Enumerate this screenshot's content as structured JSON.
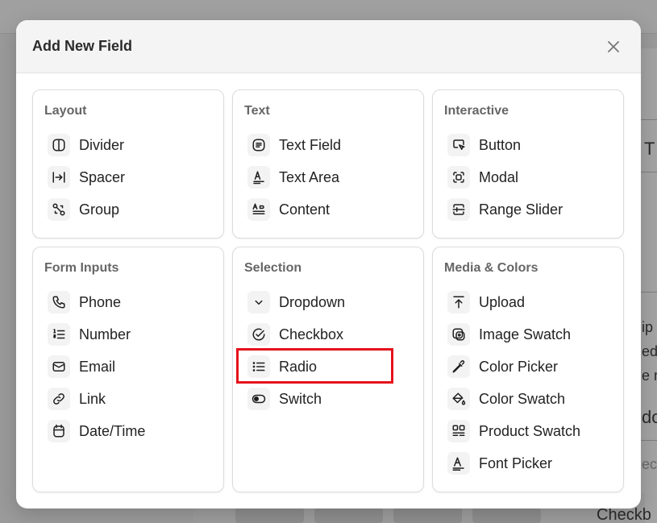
{
  "background": {
    "frag_right_top": "T",
    "frag_right_mid1": "ip",
    "frag_right_mid2": "ed",
    "frag_right_mid3": "e m",
    "frag_right_mid4": "do",
    "frag_right_mid5": "ect",
    "frag_bottom_right": "Checkb"
  },
  "modal": {
    "title": "Add New Field",
    "close_label": "×"
  },
  "sections": [
    {
      "title": "Layout",
      "items": [
        {
          "label": "Divider",
          "icon": "divider-icon"
        },
        {
          "label": "Spacer",
          "icon": "spacer-icon"
        },
        {
          "label": "Group",
          "icon": "group-icon"
        }
      ]
    },
    {
      "title": "Text",
      "items": [
        {
          "label": "Text Field",
          "icon": "text-field-icon"
        },
        {
          "label": "Text Area",
          "icon": "text-area-icon"
        },
        {
          "label": "Content",
          "icon": "content-icon"
        }
      ]
    },
    {
      "title": "Interactive",
      "items": [
        {
          "label": "Button",
          "icon": "button-icon"
        },
        {
          "label": "Modal",
          "icon": "modal-icon"
        },
        {
          "label": "Range Slider",
          "icon": "range-slider-icon"
        }
      ]
    },
    {
      "title": "Form Inputs",
      "items": [
        {
          "label": "Phone",
          "icon": "phone-icon"
        },
        {
          "label": "Number",
          "icon": "number-list-icon"
        },
        {
          "label": "Email",
          "icon": "email-icon"
        },
        {
          "label": "Link",
          "icon": "link-icon"
        },
        {
          "label": "Date/Time",
          "icon": "calendar-icon"
        }
      ]
    },
    {
      "title": "Selection",
      "items": [
        {
          "label": "Dropdown",
          "icon": "chevron-down-icon"
        },
        {
          "label": "Checkbox",
          "icon": "check-circle-icon"
        },
        {
          "label": "Radio",
          "icon": "list-icon"
        },
        {
          "label": "Switch",
          "icon": "toggle-icon"
        }
      ]
    },
    {
      "title": "Media & Colors",
      "items": [
        {
          "label": "Upload",
          "icon": "upload-icon"
        },
        {
          "label": "Image Swatch",
          "icon": "image-swatch-icon"
        },
        {
          "label": "Color Picker",
          "icon": "eyedropper-icon"
        },
        {
          "label": "Color Swatch",
          "icon": "paint-bucket-icon"
        },
        {
          "label": "Product Swatch",
          "icon": "product-grid-icon"
        },
        {
          "label": "Font Picker",
          "icon": "font-icon"
        }
      ]
    }
  ],
  "colors": {
    "highlight": "#e5121b",
    "icon_bg": "#f3f3f3"
  }
}
